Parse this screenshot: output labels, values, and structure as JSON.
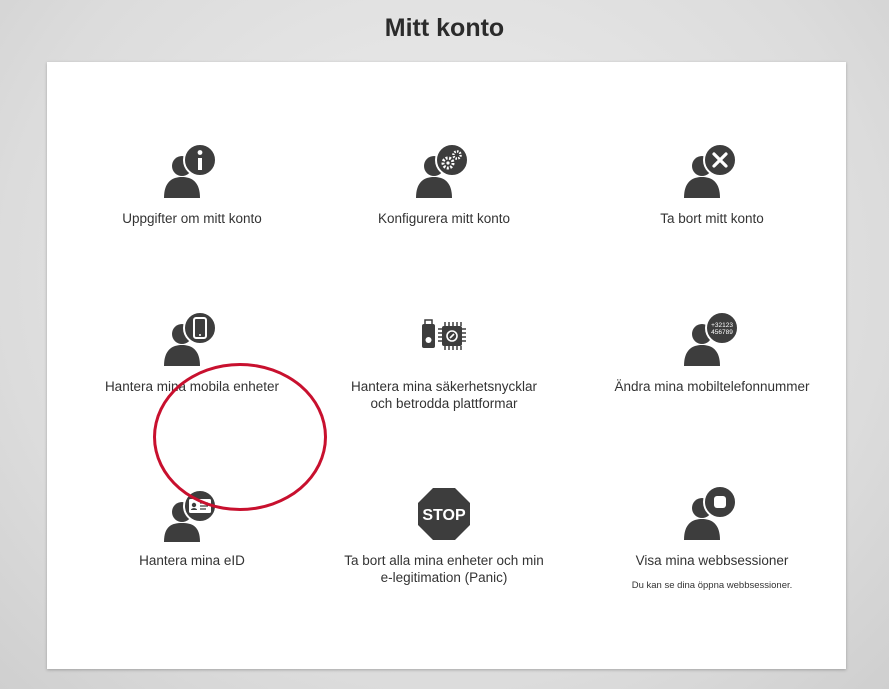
{
  "page": {
    "title": "Mitt konto"
  },
  "tiles": [
    {
      "label": "Uppgifter om mitt konto",
      "icon": "user-info-icon"
    },
    {
      "label": "Konfigurera mitt konto",
      "icon": "user-settings-icon"
    },
    {
      "label": "Ta bort mitt konto",
      "icon": "user-remove-icon"
    },
    {
      "label": "Hantera mina mobila enheter",
      "icon": "user-mobile-device-icon"
    },
    {
      "label": "Hantera mina säkerhetsnycklar och betrodda plattformar",
      "icon": "security-key-chip-icon"
    },
    {
      "label": "Ändra mina mobiltelefonnummer",
      "icon": "user-phone-number-icon",
      "badge": "+32123 456789"
    },
    {
      "label": "Hantera mina eID",
      "icon": "user-id-card-icon"
    },
    {
      "label": "Ta bort alla mina enheter och min e-legitimation (Panic)",
      "icon": "stop-sign-icon",
      "badge": "STOP"
    },
    {
      "label": "Visa mina webbsessioner",
      "icon": "user-web-session-icon",
      "sub": "Du kan se dina öppna webbsessioner."
    }
  ],
  "colors": {
    "icon": "#3d3d3d",
    "highlight": "#c8102e",
    "panel": "#ffffff"
  }
}
